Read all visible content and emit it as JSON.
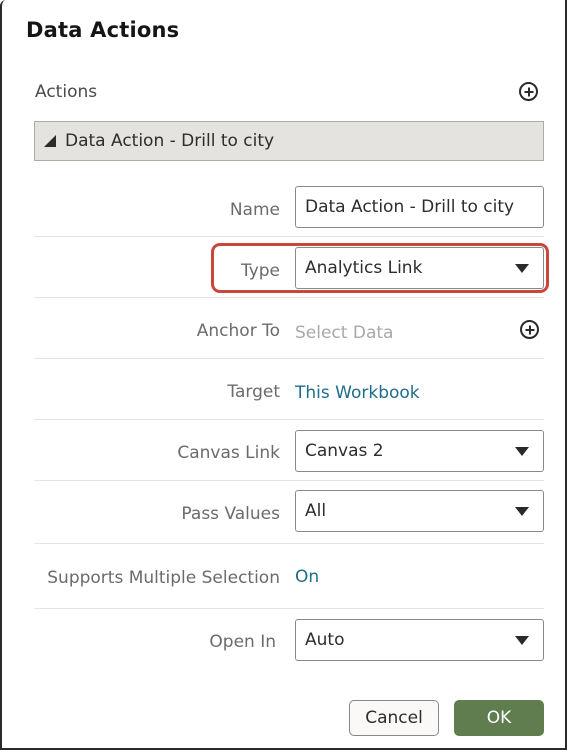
{
  "dialog": {
    "title": "Data Actions",
    "actions_label": "Actions",
    "add_action_icon": "plus-circle-icon",
    "accordion": {
      "expanded": true,
      "label": "Data Action - Drill to city"
    }
  },
  "form": {
    "name": {
      "label": "Name",
      "value": "Data Action - Drill to city"
    },
    "type": {
      "label": "Type",
      "value": "Analytics Link",
      "highlighted": true,
      "highlight_color": "#c8473c"
    },
    "anchor_to": {
      "label": "Anchor To",
      "placeholder": "Select Data",
      "add_icon": "plus-circle-icon"
    },
    "target": {
      "label": "Target",
      "value": "This Workbook"
    },
    "canvas_link": {
      "label": "Canvas Link",
      "value": "Canvas 2"
    },
    "pass_values": {
      "label": "Pass Values",
      "value": "All"
    },
    "supports_multiple_selection": {
      "label": "Supports Multiple Selection",
      "value": "On"
    },
    "open_in": {
      "label": "Open In",
      "value": "Auto"
    }
  },
  "buttons": {
    "cancel": "Cancel",
    "ok": "OK"
  },
  "colors": {
    "primary_button": "#5f7d4f",
    "link": "#1e6d8a",
    "accordion_bg": "#e4e3df",
    "highlight": "#c8473c"
  }
}
